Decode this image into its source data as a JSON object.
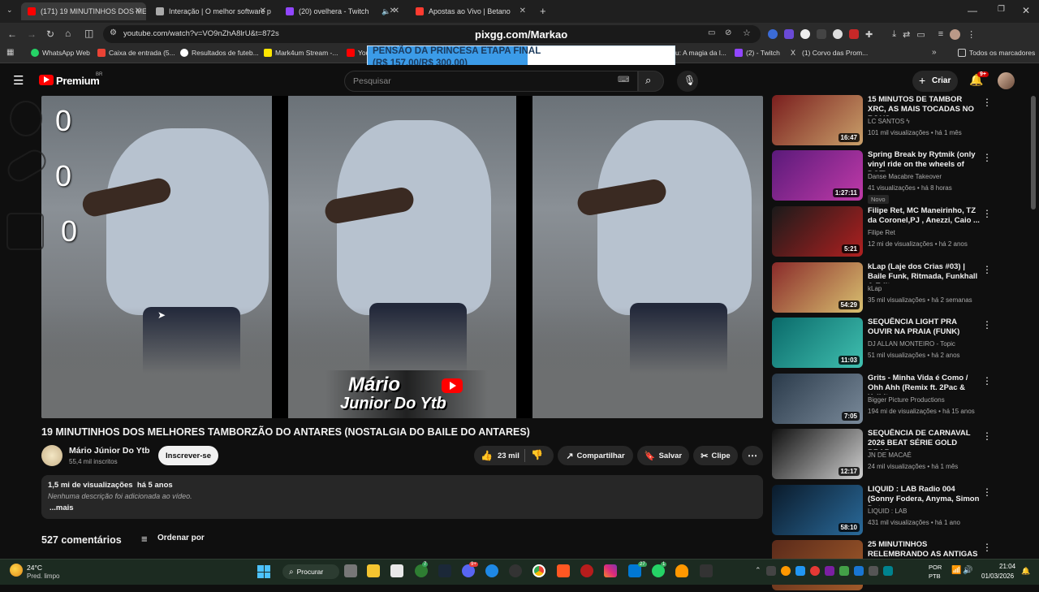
{
  "browser": {
    "tabs": [
      {
        "label": "(171) 19 MINUTINHOS DOS ME",
        "active": true,
        "color": "#ff0000"
      },
      {
        "label": "Interação | O melhor software p",
        "active": false,
        "color": "#aaaaaa"
      },
      {
        "label": "(20) ovelhera - Twitch",
        "active": false,
        "color": "#9146ff"
      },
      {
        "label": "",
        "active": false,
        "color": "#cccccc"
      },
      {
        "label": "Apostas ao Vivo | Betano",
        "active": false,
        "color": "#ff3b30"
      }
    ],
    "url": "youtube.com/watch?v=VO9nZhA8lrU&t=872s",
    "overlay_url": "pixgg.com/Markao",
    "bookmarks": [
      {
        "label": "WhatsApp Web",
        "color": "#25d366"
      },
      {
        "label": "Caixa de entrada (5...",
        "color": "#ea4335"
      },
      {
        "label": "Resultados de futeb...",
        "color": "#ffffff"
      },
      {
        "label": "Mark4um Stream -...",
        "color": "#ffe600"
      },
      {
        "label": "You",
        "color": "#ff0000"
      },
      {
        "label": "u: A magia da l...",
        "color": "#888888"
      },
      {
        "label": "(2) - Twitch",
        "color": "#9146ff"
      },
      {
        "label": "(1) Corvo das Prom...",
        "color": "#ffffff"
      }
    ],
    "bookmarks_all": "Todos os marcadores"
  },
  "overlay": {
    "line1": "PENSÃO DA PRINCESA ETAPA FINAL",
    "line2": "(R$ 157,00/R$ 300,00)",
    "progress": 0.52
  },
  "youtube": {
    "logo_text": "Premium",
    "logo_region": "BR",
    "search_placeholder": "Pesquisar",
    "create_label": "Criar",
    "notif_count": "9+",
    "stream_counters": [
      "0",
      "0",
      "0"
    ],
    "watermark_line1": "Mário",
    "watermark_line2": "Junior Do Ytb",
    "video_title": "19 MINUTINHOS DOS MELHORES TAMBORZÃO DO ANTARES (NOSTALGIA DO BAILE DO ANTARES)",
    "channel_name": "Mário Júnior Do Ytb",
    "subscribers": "55,4 mil inscritos",
    "subscribe_label": "Inscrever-se",
    "likes": "23 mil",
    "share_label": "Compartilhar",
    "save_label": "Salvar",
    "clip_label": "Clipe",
    "views_line": "1,5 mi de visualizações  há 5 anos",
    "description": "Nenhuma descrição foi adicionada ao vídeo.",
    "more_label": "...mais",
    "comments_count": "527 comentários",
    "sort_label": "Ordenar por"
  },
  "recommendations": [
    {
      "title": "15 MINUTOS DE TAMBOR XRC, AS MAIS TOCADAS NO RJ VS ...",
      "channel": "LC SANTOS ϟ",
      "meta": "101 mil visualizações • há 1 mês",
      "duration": "16:47",
      "badge": "",
      "c1": "#7a1e1e",
      "c2": "#c9a06a"
    },
    {
      "title": "Spring Break by Rytmik (only vinyl ride on the wheels of DOT)",
      "channel": "Danse Macabre Takeover",
      "meta": "41 visualizações • há 8 horas",
      "duration": "1:27:11",
      "badge": "Novo",
      "c1": "#5a1a7a",
      "c2": "#c03aa8"
    },
    {
      "title": "Filipe Ret, MC Maneirinho, TZ da Coronel,PJ , Anezzi, Caio ...",
      "channel": "Filipe Ret",
      "meta": "12 mi de visualizações • há 2 anos",
      "duration": "5:21",
      "badge": "",
      "c1": "#1a1a1a",
      "c2": "#b02020"
    },
    {
      "title": "kLap (Laje dos Crias #03) | Baile Funk, Ritmada, Funkhall & Edit...",
      "channel": "kLap",
      "meta": "35 mil visualizações • há 2 semanas",
      "duration": "54:29",
      "badge": "",
      "c1": "#8a2a2a",
      "c2": "#d8c070"
    },
    {
      "title": "SEQUÊNCIA LIGHT PRA OUVIR NA PRAIA (FUNK)",
      "channel": "DJ ALLAN MONTEIRO - Topic",
      "meta": "51 mil visualizações • há 2 anos",
      "duration": "11:03",
      "badge": "",
      "c1": "#0a6a6a",
      "c2": "#40c0b0"
    },
    {
      "title": "Grits - Minha Vida é Como / Ohh Ahh (Remix ft. 2Pac & Xzibit - ...",
      "channel": "Bigger Picture Productions",
      "meta": "194 mi de visualizações • há 15 anos",
      "duration": "7:05",
      "badge": "",
      "c1": "#2a3a4a",
      "c2": "#7a8a9a"
    },
    {
      "title": "SEQUÊNCIA DE CARNAVAL 2026 BEAT SÉRIE GOLD BRAB...",
      "channel": "JN DE MACAÉ",
      "meta": "24 mil visualizações • há 1 mês",
      "duration": "12:17",
      "badge": "",
      "c1": "#101010",
      "c2": "#d0d0d0"
    },
    {
      "title": "LIQUID : LAB Radio 004 (Sonny Fodera, Anyma, Simon Doty, ...",
      "channel": "LIQUID : LAB",
      "meta": "431 mil visualizações • há 1 ano",
      "duration": "58:10",
      "badge": "",
      "c1": "#0a1a2a",
      "c2": "#2a6a9a"
    },
    {
      "title": "25 MINUTINHOS RELEMBRANDO AS ANTIGAS",
      "channel": "",
      "meta": "",
      "duration": "",
      "badge": "",
      "c1": "#5a2a1a",
      "c2": "#a05a2a"
    }
  ],
  "taskbar": {
    "weather_temp": "24°C",
    "weather_desc": "Pred. limpo",
    "search_label": "Procurar",
    "lang1": "POR",
    "lang2": "PTB",
    "time": "21:04",
    "date": "01/03/2026"
  }
}
